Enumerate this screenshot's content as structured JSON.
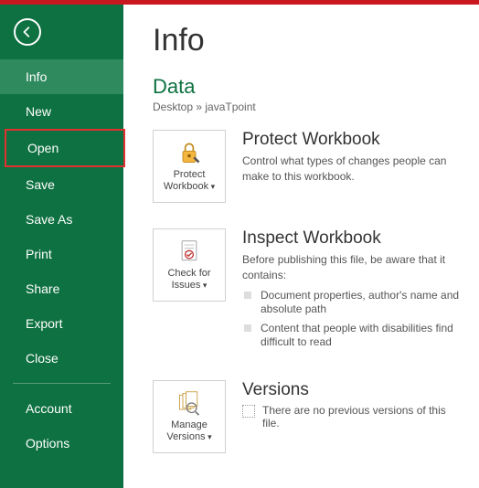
{
  "sidebar": {
    "items": [
      {
        "label": "Info",
        "active": true
      },
      {
        "label": "New"
      },
      {
        "label": "Open",
        "highlighted": true
      },
      {
        "label": "Save"
      },
      {
        "label": "Save As"
      },
      {
        "label": "Print"
      },
      {
        "label": "Share"
      },
      {
        "label": "Export"
      },
      {
        "label": "Close"
      }
    ],
    "footer": [
      {
        "label": "Account"
      },
      {
        "label": "Options"
      }
    ]
  },
  "main": {
    "title": "Info",
    "file_name": "Data",
    "breadcrumb": "Desktop » javaTpoint",
    "protect": {
      "tile": "Protect Workbook",
      "heading": "Protect Workbook",
      "desc": "Control what types of changes people can make to this workbook."
    },
    "inspect": {
      "tile": "Check for Issues",
      "heading": "Inspect Workbook",
      "desc": "Before publishing this file, be aware that it contains:",
      "bullets": [
        "Document properties, author's name and absolute path",
        "Content that people with disabilities find difficult to read"
      ]
    },
    "versions": {
      "tile": "Manage Versions",
      "heading": "Versions",
      "desc": "There are no previous versions of this file."
    }
  }
}
